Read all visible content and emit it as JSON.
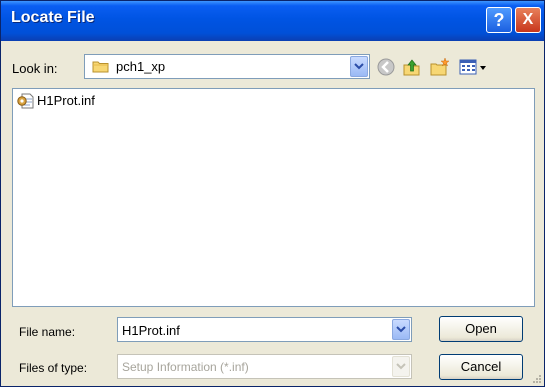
{
  "window": {
    "title": "Locate File",
    "help_label": "?",
    "close_label": "X"
  },
  "lookin": {
    "label": "Look in:",
    "value": "pch1_xp"
  },
  "toolbar": [
    "back-icon",
    "up-folder-icon",
    "new-folder-icon",
    "view-menu-icon"
  ],
  "files": [
    {
      "name": "H1Prot.inf",
      "icon": "setup-info-file-icon"
    }
  ],
  "filename": {
    "label": "File name:",
    "value": "H1Prot.inf"
  },
  "filetype": {
    "label": "Files of type:",
    "value": "Setup Information (*.inf)"
  },
  "buttons": {
    "open": "Open",
    "cancel": "Cancel"
  },
  "colors": {
    "titlebar": "#0054e3",
    "face": "#ece9d8",
    "border": "#7f9db9"
  }
}
